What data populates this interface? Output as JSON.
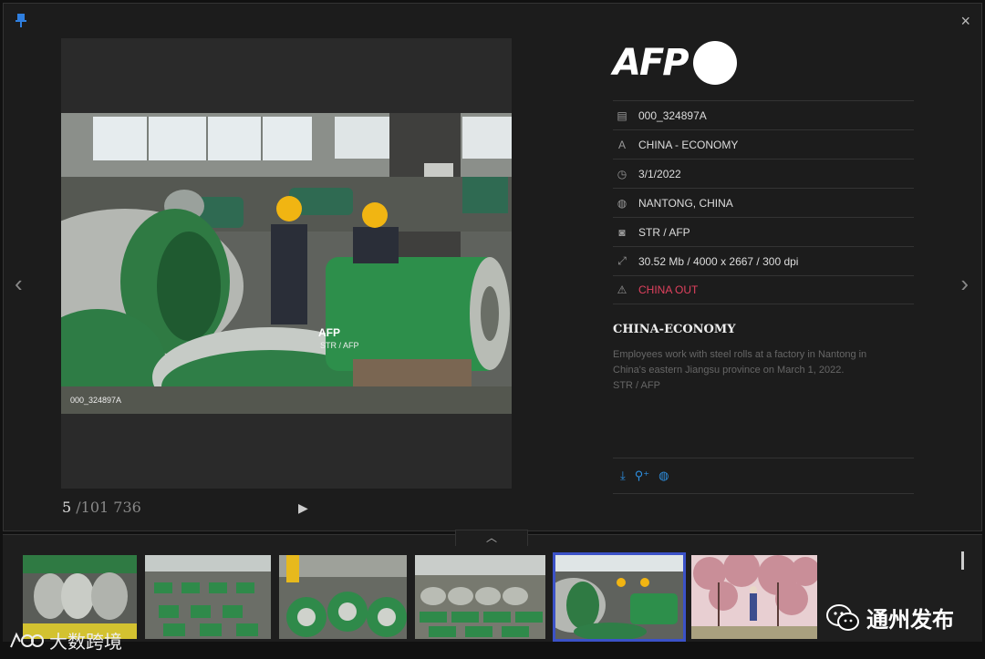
{
  "viewer": {
    "close_label": "×",
    "prev_label": "‹",
    "next_label": "›",
    "counter_current": "5",
    "counter_total": " /101 736",
    "play_label": "▶"
  },
  "photo": {
    "watermark": "AFP",
    "credit": "STR / AFP",
    "id": "000_324897A"
  },
  "info": {
    "logo_text": "AFP",
    "meta": [
      {
        "icon": "document-icon",
        "glyph": "▤",
        "text": "000_324897A"
      },
      {
        "icon": "letter-a-icon",
        "glyph": "A",
        "text": "CHINA - ECONOMY"
      },
      {
        "icon": "clock-icon",
        "glyph": "◷",
        "text": "3/1/2022"
      },
      {
        "icon": "globe-icon",
        "glyph": "◍",
        "text": "NANTONG, CHINA"
      },
      {
        "icon": "camera-icon",
        "glyph": "◙",
        "text": "STR / AFP"
      },
      {
        "icon": "resize-icon",
        "glyph": "⤢",
        "text": "30.52 Mb / 4000 x 2667 / 300 dpi"
      },
      {
        "icon": "warning-icon",
        "glyph": "⚠",
        "text": "CHINA OUT"
      }
    ],
    "caption_title": "CHINA-ECONOMY",
    "caption_body": "Employees work with steel rolls at a factory in Nantong in China's eastern Jiangsu province on March 1, 2022.",
    "caption_credit": "STR / AFP",
    "actions": [
      {
        "icon": "download-icon",
        "glyph": "⤓"
      },
      {
        "icon": "search-similar-icon",
        "glyph": "⚲⁺"
      },
      {
        "icon": "globe-icon",
        "glyph": "◍"
      }
    ],
    "accent_color": "#2e8fe0",
    "restriction_color": "#e0415e"
  },
  "strip": {
    "toggle_label": "︿",
    "active_index": 4
  },
  "overlay": {
    "wechat_text": "通州发布",
    "bottom_text": "大数跨境"
  }
}
